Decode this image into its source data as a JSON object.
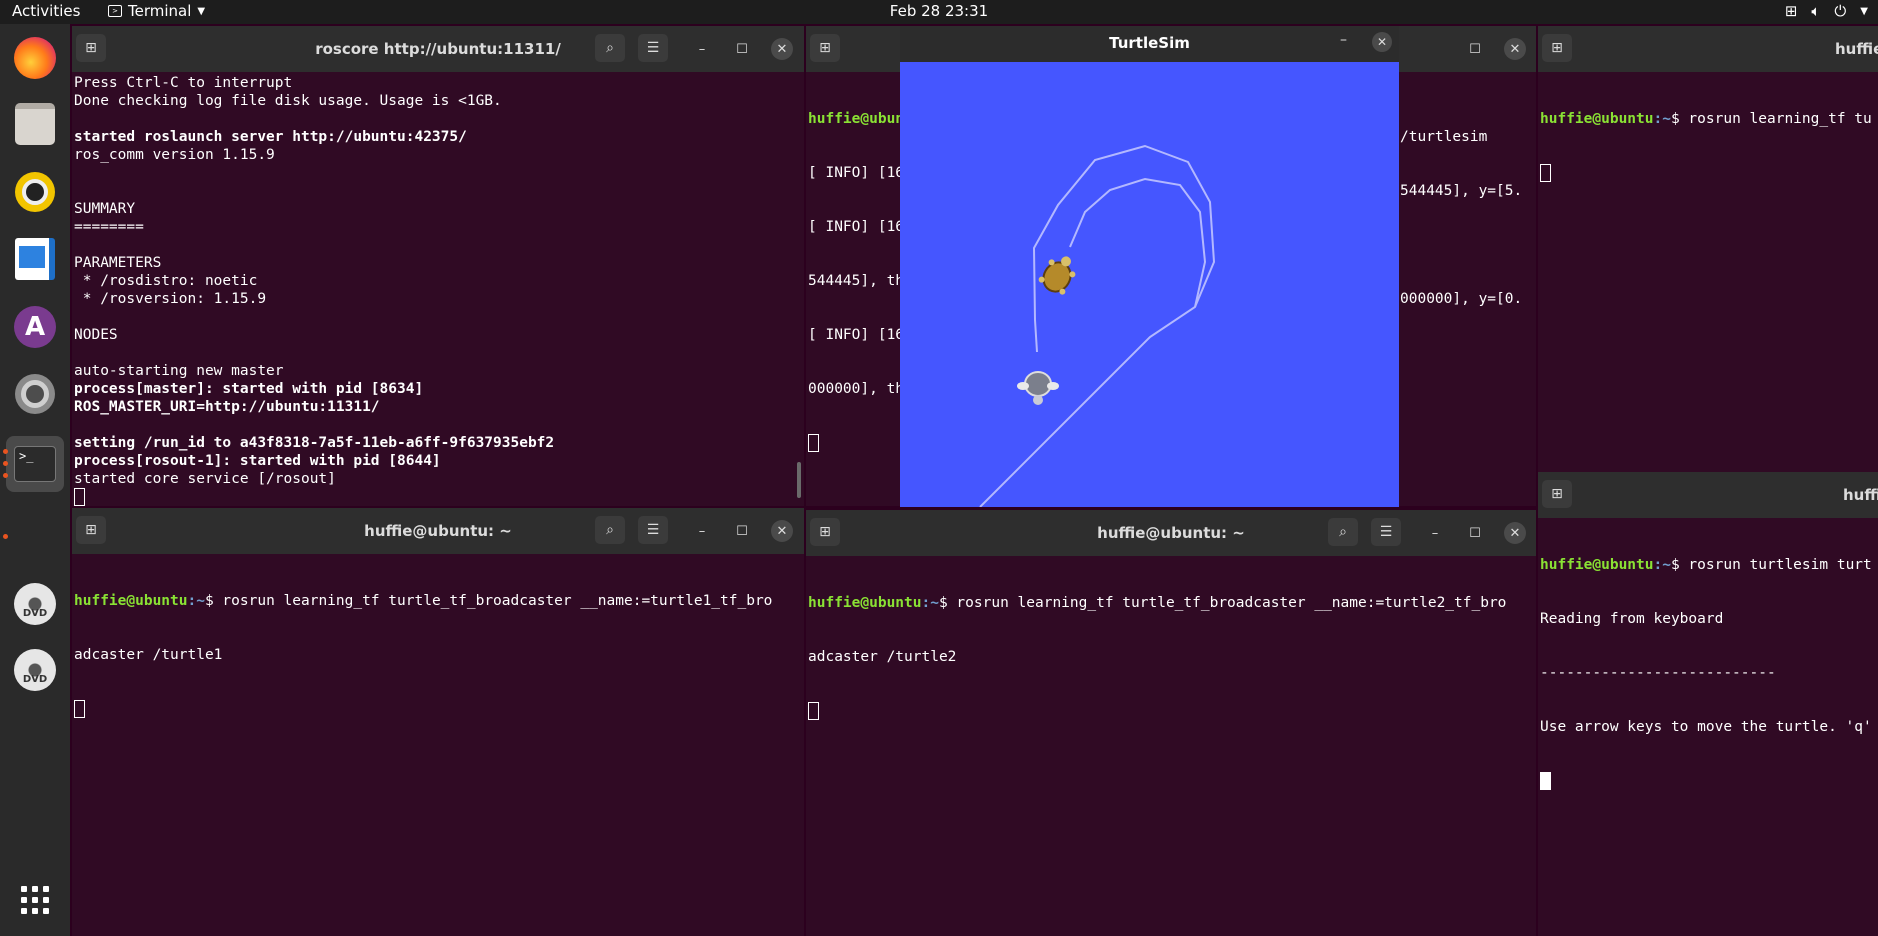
{
  "topbar": {
    "activities": "Activities",
    "app_menu": "Terminal",
    "clock": "Feb 28  23:31"
  },
  "dock": {
    "items": [
      "firefox-icon",
      "files-icon",
      "rhythmbox-icon",
      "libreoffice-writer-icon",
      "software-center-icon",
      "settings-icon",
      "terminal-icon",
      "dvd-icon",
      "dvd-icon",
      "show-apps-icon"
    ]
  },
  "windows": {
    "roscore": {
      "title": "roscore http://ubuntu:11311/",
      "lines": [
        {
          "t": "Press Ctrl-C to interrupt",
          "b": false
        },
        {
          "t": "Done checking log file disk usage. Usage is <1GB.",
          "b": false
        },
        {
          "t": "",
          "b": false
        },
        {
          "t": "started roslaunch server http://ubuntu:42375/",
          "b": true
        },
        {
          "t": "ros_comm version 1.15.9",
          "b": false
        },
        {
          "t": "",
          "b": false
        },
        {
          "t": "",
          "b": false
        },
        {
          "t": "SUMMARY",
          "b": false
        },
        {
          "t": "========",
          "b": false
        },
        {
          "t": "",
          "b": false
        },
        {
          "t": "PARAMETERS",
          "b": false
        },
        {
          "t": " * /rosdistro: noetic",
          "b": false
        },
        {
          "t": " * /rosversion: 1.15.9",
          "b": false
        },
        {
          "t": "",
          "b": false
        },
        {
          "t": "NODES",
          "b": false
        },
        {
          "t": "",
          "b": false
        },
        {
          "t": "auto-starting new master",
          "b": false
        },
        {
          "t": "process[master]: started with pid [8634]",
          "b": true
        },
        {
          "t": "ROS_MASTER_URI=http://ubuntu:11311/",
          "b": true
        },
        {
          "t": "",
          "b": false
        },
        {
          "t": "setting /run_id to a43f8318-7a5f-11eb-a6ff-9f637935ebf2",
          "b": true
        },
        {
          "t": "process[rosout-1]: started with pid [8644]",
          "b": true
        },
        {
          "t": "started core service [/rosout]",
          "b": false
        }
      ]
    },
    "turtlesim_term": {
      "prompt_user": "huffie@ubuntu",
      "lines": [
        "[ INFO] [16",
        "[ INFO] [16",
        "544445], th",
        "[ INFO] [16",
        "000000], th"
      ],
      "right_lines": [
        "/turtlesim",
        "544445], y=[5.",
        "",
        "000000], y=[0.",
        ""
      ]
    },
    "top_right": {
      "title": "huffie",
      "prompt_user": "huffie@ubuntu",
      "prompt_path": ":~",
      "command": "$ rosrun learning_tf tu"
    },
    "broadcaster1": {
      "title": "huffie@ubuntu: ~",
      "prompt_user": "huffie@ubuntu",
      "prompt_path": ":~",
      "command": "$ rosrun learning_tf turtle_tf_broadcaster __name:=turtle1_tf_bro",
      "cont": "adcaster /turtle1"
    },
    "broadcaster2": {
      "title": "huffie@ubuntu: ~",
      "prompt_user": "huffie@ubuntu",
      "prompt_path": ":~",
      "command": "$ rosrun learning_tf turtle_tf_broadcaster __name:=turtle2_tf_bro",
      "cont": "adcaster /turtle2"
    },
    "teleop": {
      "title": "huffi",
      "prompt_user": "huffie@ubuntu",
      "prompt_path": ":~",
      "command": "$ rosrun turtlesim turt",
      "line2": "Reading from keyboard",
      "line3": "---------------------------",
      "line4": "Use arrow keys to move the turtle. 'q'"
    }
  },
  "turtlesim": {
    "title": "TurtleSim",
    "background": "#4556ff",
    "path_color": "#b3b8ff"
  }
}
